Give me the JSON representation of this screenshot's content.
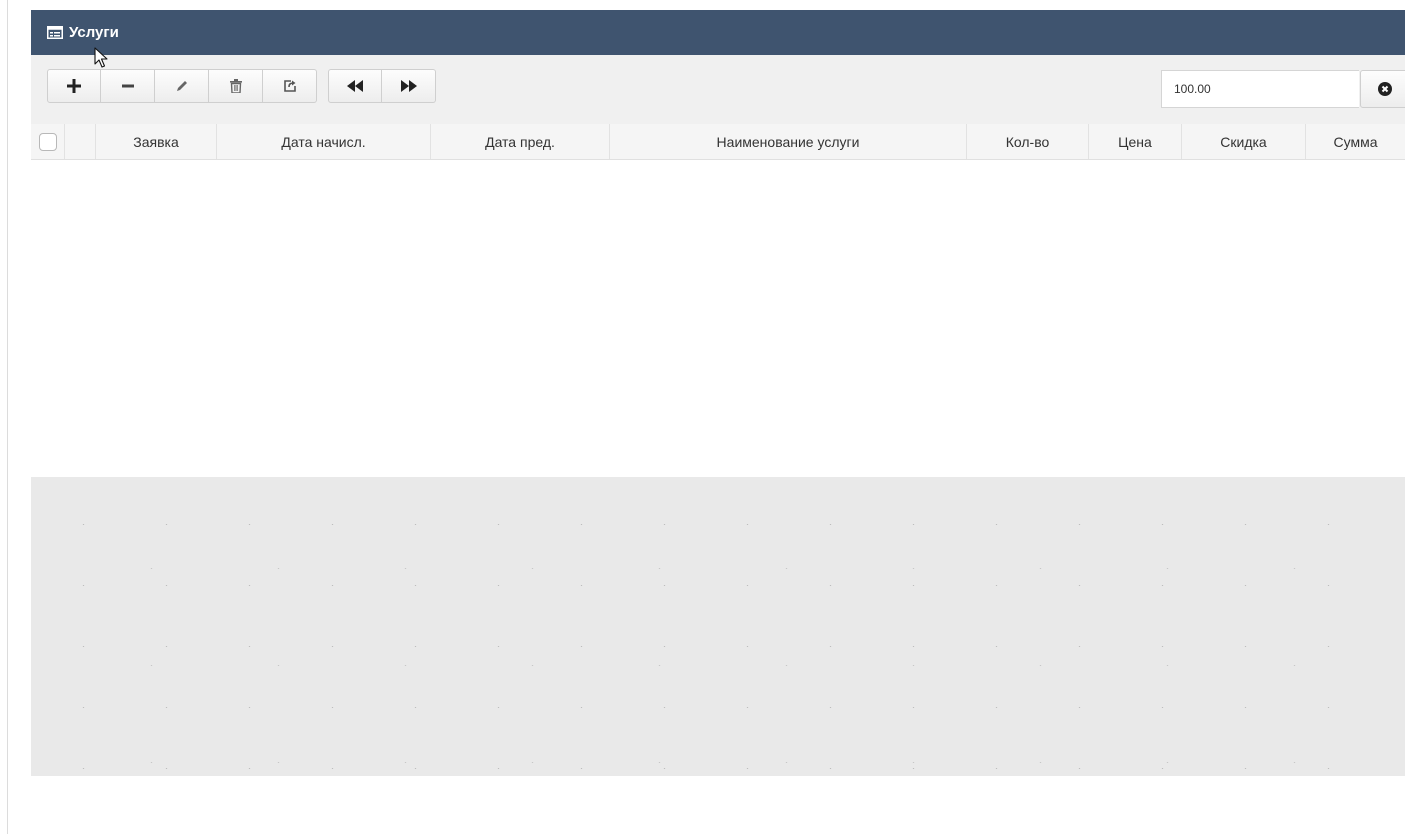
{
  "panel": {
    "title": "Услуги",
    "title_icon": "list-panel-icon"
  },
  "toolbar": {
    "buttons": [
      {
        "name": "add",
        "icon": "plus-icon"
      },
      {
        "name": "remove",
        "icon": "minus-icon"
      },
      {
        "name": "edit",
        "icon": "pencil-icon"
      },
      {
        "name": "delete",
        "icon": "trash-icon"
      },
      {
        "name": "export",
        "icon": "share-icon"
      }
    ],
    "nav_buttons": [
      {
        "name": "back",
        "icon": "fast-backward-icon"
      },
      {
        "name": "forward",
        "icon": "fast-forward-icon"
      }
    ],
    "input_value": "100.00",
    "clear_icon": "remove-circle-icon"
  },
  "grid": {
    "columns": [
      "Заявка",
      "Дата начисл.",
      "Дата пред.",
      "Наименование услуги",
      "Кол-во",
      "Цена",
      "Скидка",
      "Сумма"
    ],
    "rows": []
  },
  "colors": {
    "title_bar": "#3f546f",
    "toolbar_bg": "#f0f0f0",
    "header_bg": "#f5f5f5",
    "empty_area": "#e9e9e9"
  }
}
